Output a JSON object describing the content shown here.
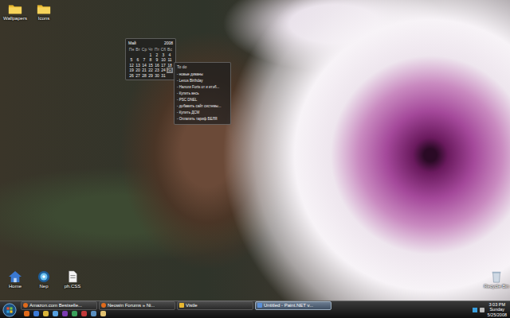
{
  "top_icons": [
    {
      "label": "Wallpapers",
      "kind": "folder"
    },
    {
      "label": "Icons",
      "kind": "folder"
    }
  ],
  "bottom_icons": [
    {
      "label": "Home",
      "kind": "home"
    },
    {
      "label": "Nep",
      "kind": "orb"
    },
    {
      "label": "ph.CSS",
      "kind": "file"
    }
  ],
  "recycle_bin": {
    "label": "Recycle Bin"
  },
  "calendar": {
    "month": "Май",
    "year": "2008",
    "weekdays": [
      "Пн",
      "Вт",
      "Ср",
      "Чт",
      "Пт",
      "Сб",
      "Вс"
    ],
    "days": [
      {
        "day": "",
        "selected": false
      },
      {
        "day": "",
        "selected": false
      },
      {
        "day": "",
        "selected": false
      },
      {
        "day": "1",
        "selected": false
      },
      {
        "day": "2",
        "selected": false
      },
      {
        "day": "3",
        "selected": false
      },
      {
        "day": "4",
        "selected": false
      },
      {
        "day": "5",
        "selected": false
      },
      {
        "day": "6",
        "selected": false
      },
      {
        "day": "7",
        "selected": false
      },
      {
        "day": "8",
        "selected": false
      },
      {
        "day": "9",
        "selected": false
      },
      {
        "day": "10",
        "selected": false
      },
      {
        "day": "11",
        "selected": false
      },
      {
        "day": "12",
        "selected": false
      },
      {
        "day": "13",
        "selected": false
      },
      {
        "day": "14",
        "selected": false
      },
      {
        "day": "15",
        "selected": false
      },
      {
        "day": "16",
        "selected": false
      },
      {
        "day": "17",
        "selected": false
      },
      {
        "day": "18",
        "selected": false
      },
      {
        "day": "19",
        "selected": false
      },
      {
        "day": "20",
        "selected": false
      },
      {
        "day": "21",
        "selected": false
      },
      {
        "day": "22",
        "selected": false
      },
      {
        "day": "23",
        "selected": false
      },
      {
        "day": "24",
        "selected": false
      },
      {
        "day": "25",
        "selected": true
      },
      {
        "day": "26",
        "selected": false
      },
      {
        "day": "27",
        "selected": false
      },
      {
        "day": "28",
        "selected": false
      },
      {
        "day": "29",
        "selected": false
      },
      {
        "day": "30",
        "selected": false
      },
      {
        "day": "31",
        "selected": false
      }
    ]
  },
  "todo": {
    "title": "To do",
    "items": [
      "- новые диваны",
      "- Lexus Birthday",
      "- Налоги Forts от и итэб...",
      "- Купить весь",
      "- PSC DNEL",
      "- добавить сайт системы...",
      "- Купить ДСМ",
      "- Оплатить тариф БЕЛЯ"
    ]
  },
  "tasks": [
    {
      "label": "Amazon.com Bestselle...",
      "kind": "browser",
      "selected": false
    },
    {
      "label": "Neowin Forums » Ni...",
      "kind": "browser",
      "selected": false
    },
    {
      "label": "Vistle",
      "kind": "folder",
      "selected": false
    },
    {
      "label": "Untitled - Paint.NET v...",
      "kind": "paint",
      "selected": true
    }
  ],
  "tray": {
    "time": "3:03 PM",
    "day": "Sunday",
    "date": "5/25/2008"
  }
}
